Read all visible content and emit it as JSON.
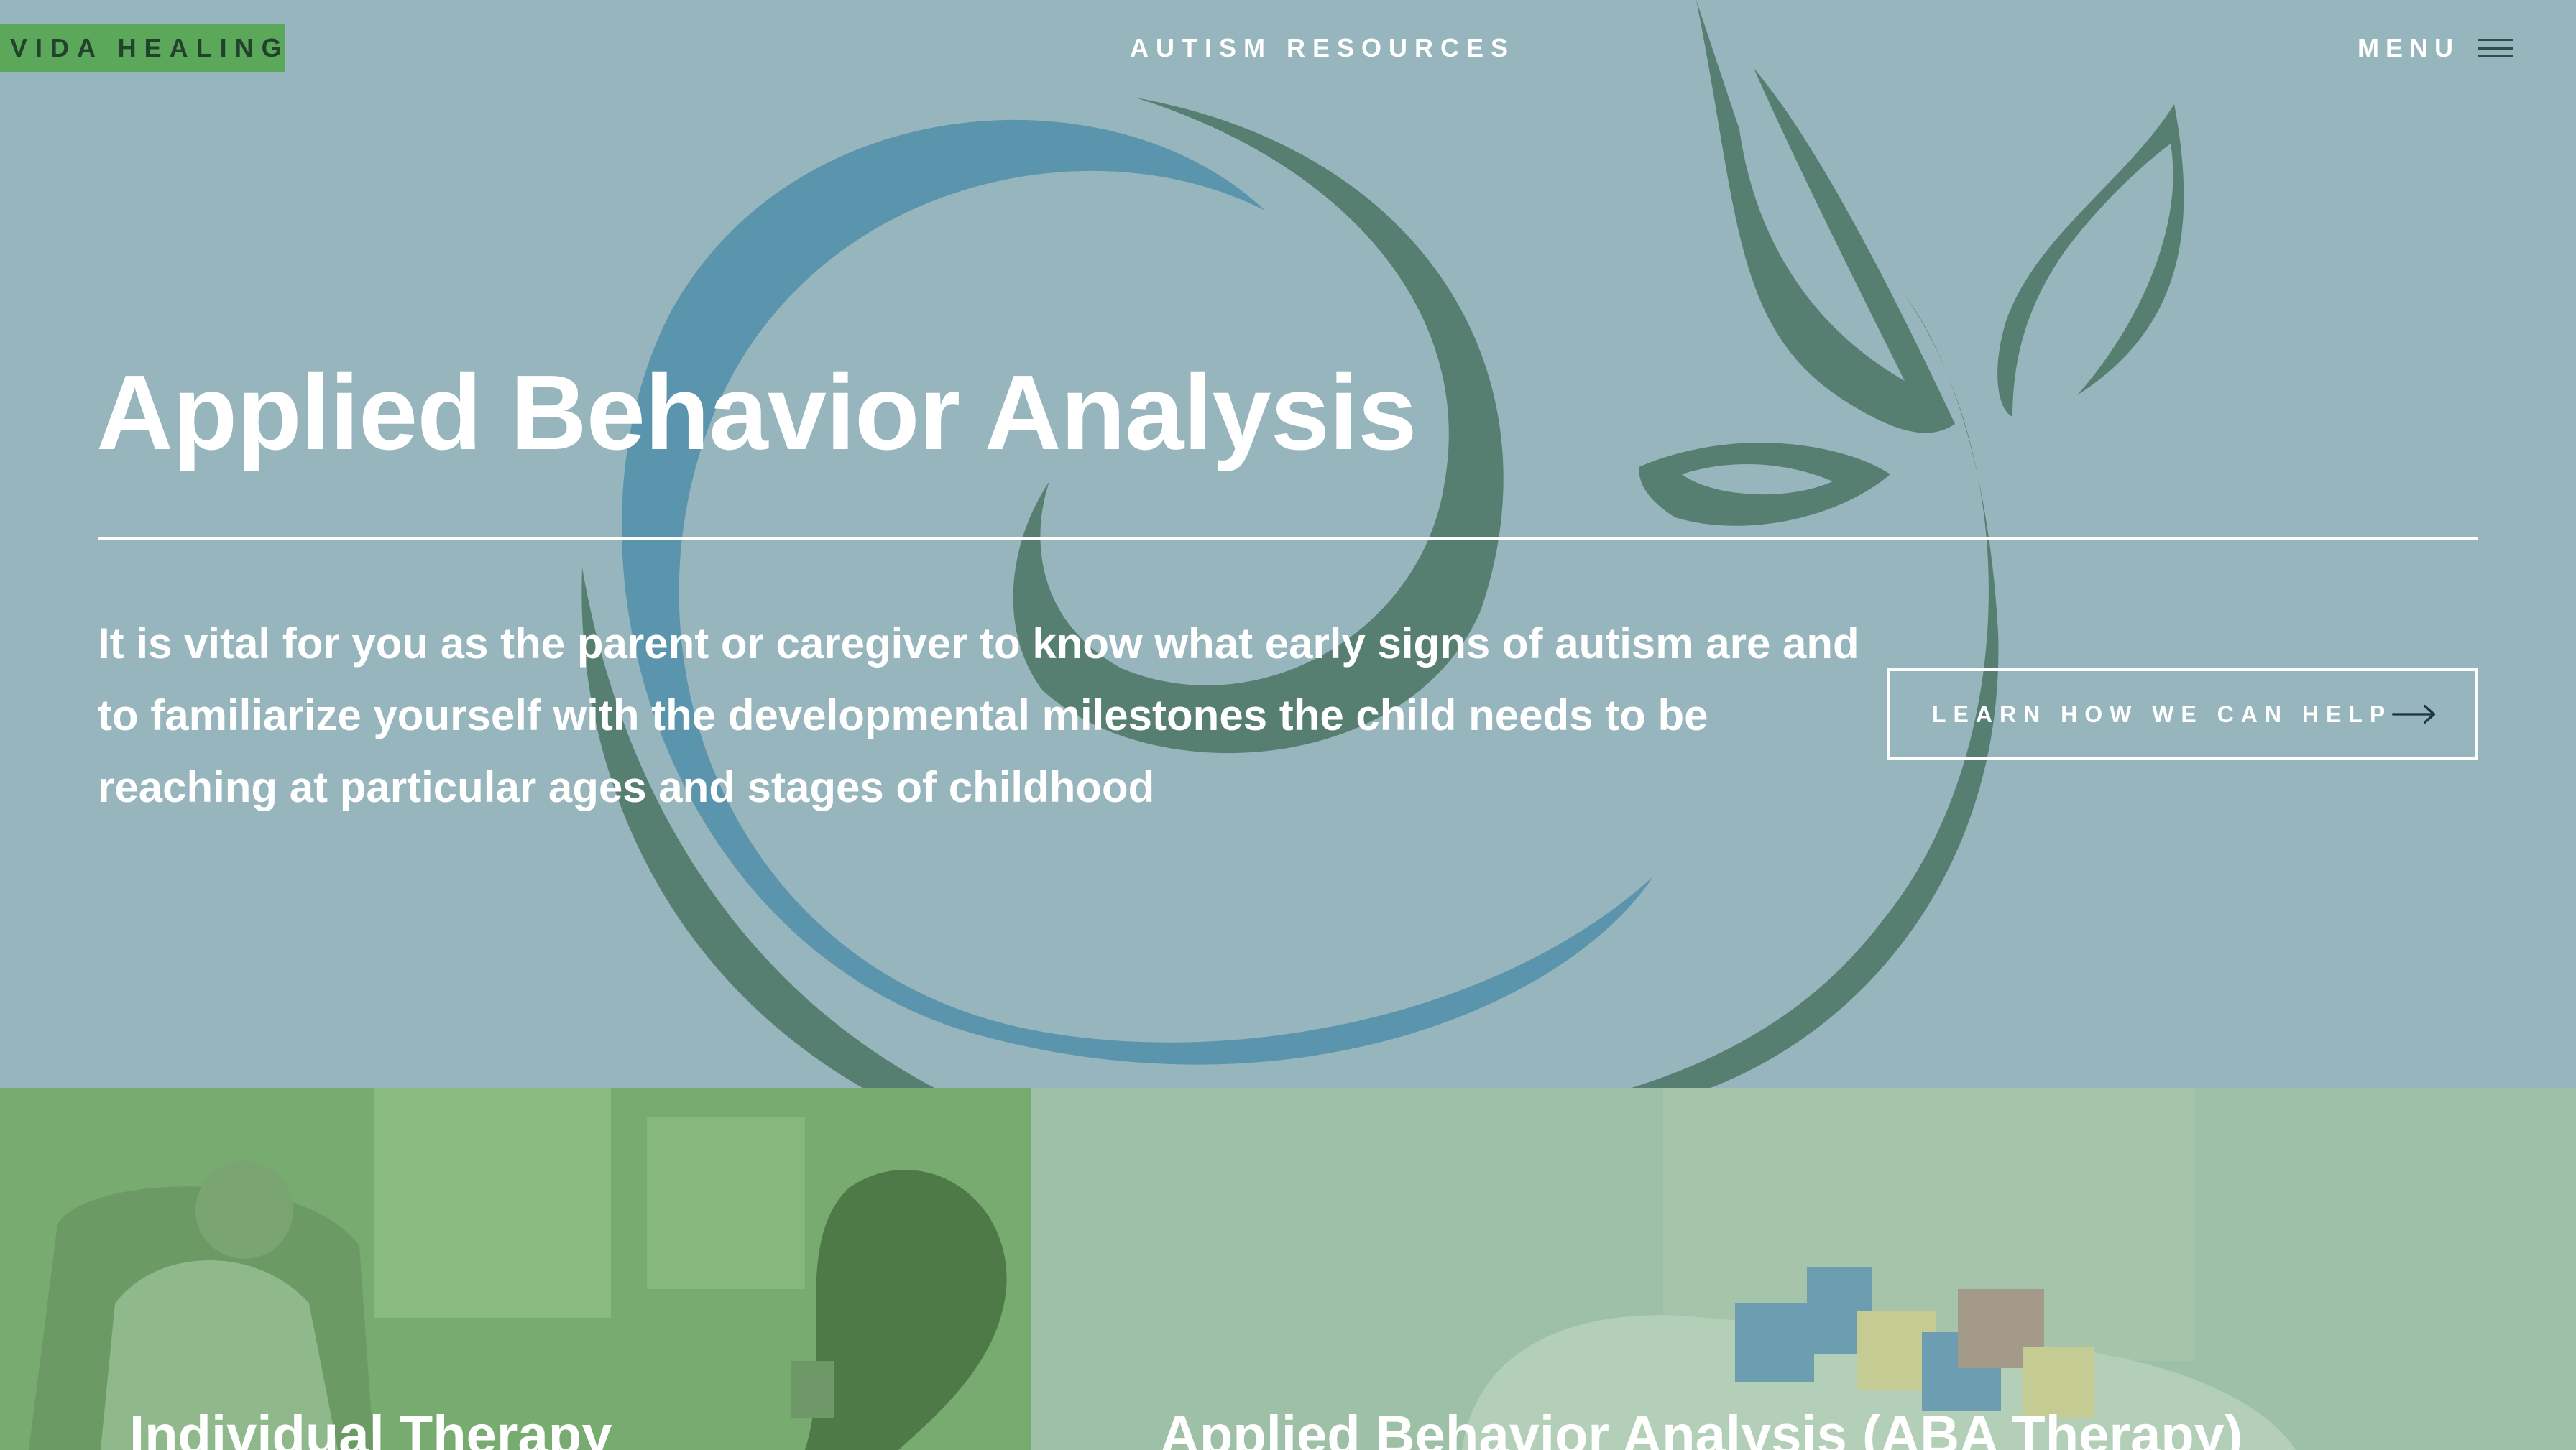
{
  "header": {
    "brand": "VIDA HEALING",
    "site_title": "AUTISM RESOURCES",
    "menu_label": "MENU"
  },
  "hero": {
    "title": "Applied Behavior Analysis",
    "intro": "It is vital for you as the parent or caregiver to know what early signs of autism are and to familiarize yourself with the developmental milestones the child needs to be reaching at particular ages and stages of childhood",
    "cta_label": "LEARN HOW WE CAN HELP"
  },
  "cards": [
    {
      "title": "Individual Therapy"
    },
    {
      "title": "Applied Behavior Analysis (ABA Therapy)"
    }
  ],
  "icons": {
    "menu": "hamburger-icon",
    "cta": "arrow-right-icon",
    "background": "spiral-leaf-logo"
  },
  "colors": {
    "hero_background": "#97b5bc",
    "brand_background": "#5ba85a",
    "spiral_blue": "#5b95ad",
    "spiral_green": "#567f72",
    "card_left": "#78ab70",
    "card_right": "#9dc0a6",
    "text": "#ffffff"
  }
}
